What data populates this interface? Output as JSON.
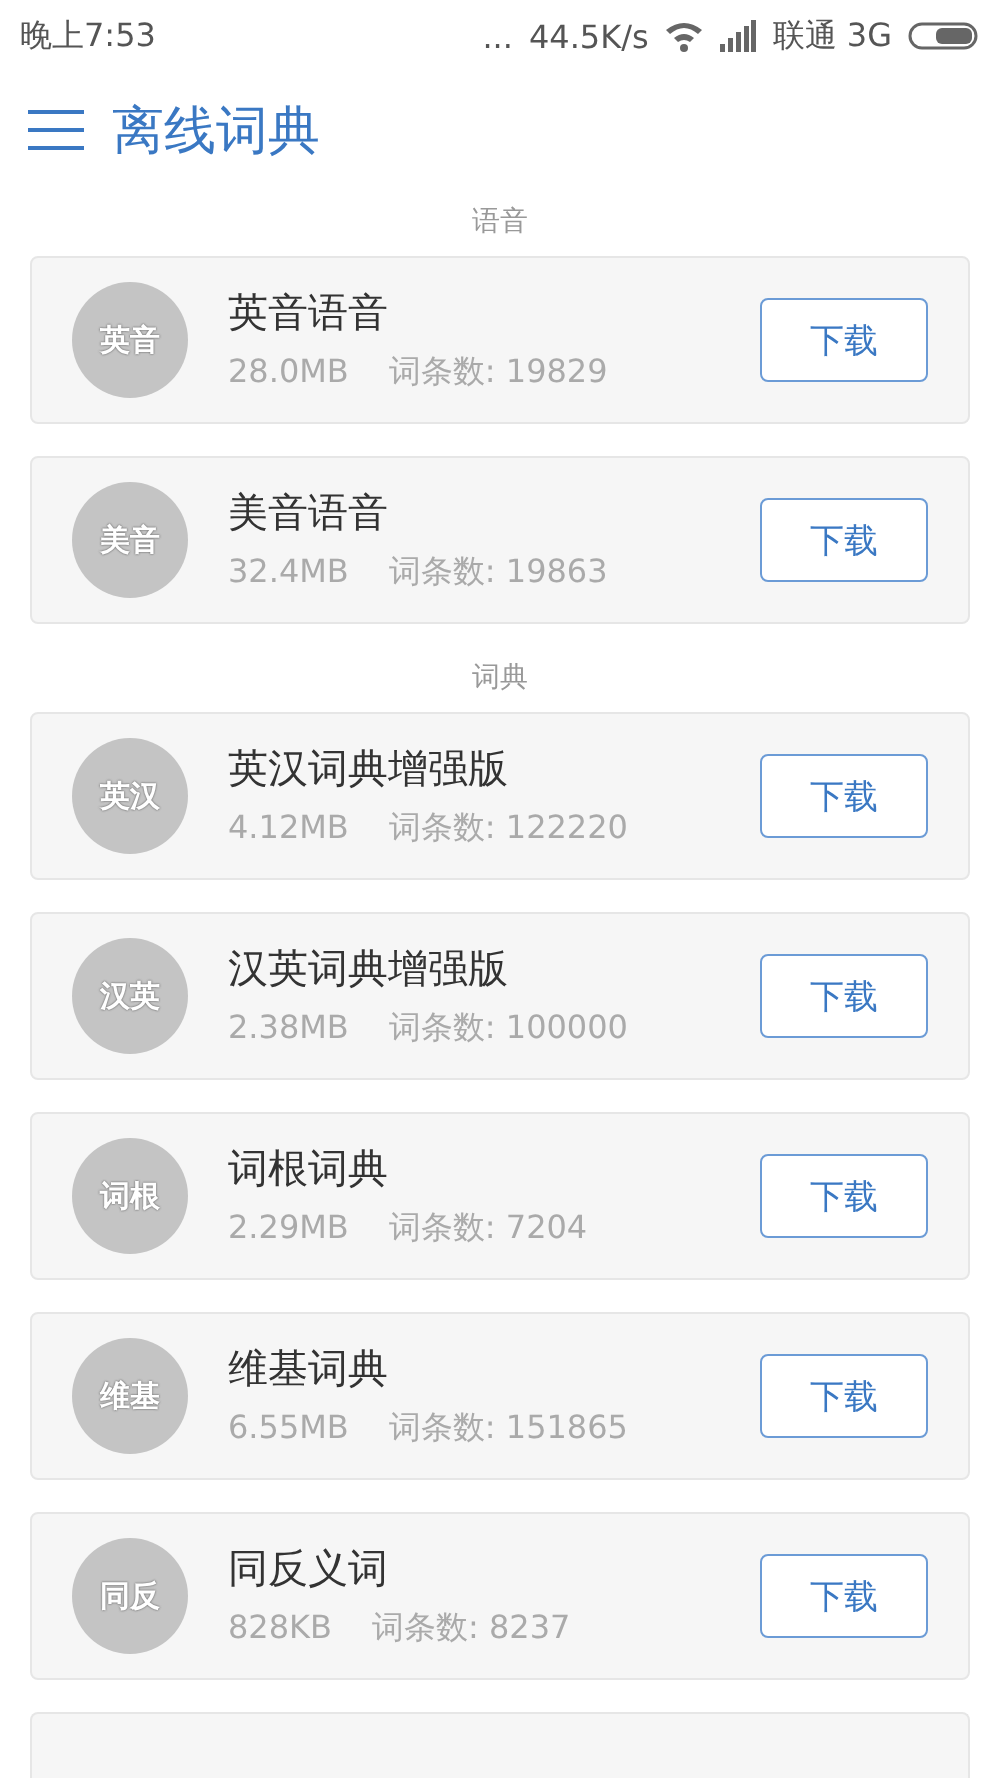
{
  "status_bar": {
    "time": "晚上7:53",
    "dots": "...",
    "speed": "44.5K/s",
    "carrier": "联通 3G"
  },
  "header": {
    "title": "离线词典"
  },
  "sections": [
    {
      "title": "语音",
      "items": [
        {
          "badge": "英音",
          "name": "英音语音",
          "size": "28.0MB",
          "entries": "词条数: 19829",
          "button": "下载"
        },
        {
          "badge": "美音",
          "name": "美音语音",
          "size": "32.4MB",
          "entries": "词条数: 19863",
          "button": "下载"
        }
      ]
    },
    {
      "title": "词典",
      "items": [
        {
          "badge": "英汉",
          "name": "英汉词典增强版",
          "size": "4.12MB",
          "entries": "词条数: 122220",
          "button": "下载"
        },
        {
          "badge": "汉英",
          "name": "汉英词典增强版",
          "size": "2.38MB",
          "entries": "词条数: 100000",
          "button": "下载"
        },
        {
          "badge": "词根",
          "name": "词根词典",
          "size": "2.29MB",
          "entries": "词条数: 7204",
          "button": "下载"
        },
        {
          "badge": "维基",
          "name": "维基词典",
          "size": "6.55MB",
          "entries": "词条数: 151865",
          "button": "下载"
        },
        {
          "badge": "同反",
          "name": "同反义词",
          "size": "828KB",
          "entries": "词条数: 8237",
          "button": "下载"
        }
      ]
    }
  ]
}
